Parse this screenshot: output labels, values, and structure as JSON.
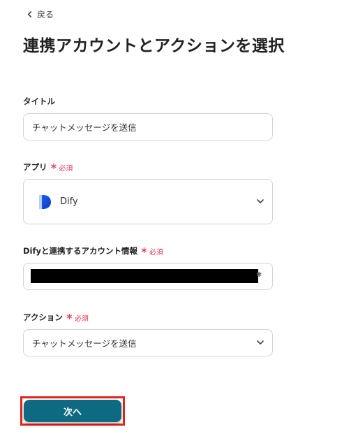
{
  "nav": {
    "back_label": "戻る"
  },
  "page": {
    "title": "連携アカウントとアクションを選択"
  },
  "form": {
    "title_field": {
      "label": "タイトル",
      "value": "チャットメッセージを送信"
    },
    "app_field": {
      "label": "アプリ",
      "required_label": "必須",
      "value": "Dify",
      "icon": "dify-logo"
    },
    "account_field": {
      "label": "Difyと連携するアカウント情報",
      "required_label": "必須"
    },
    "action_field": {
      "label": "アクション",
      "required_label": "必須",
      "value": "チャットメッセージを送信"
    }
  },
  "actions": {
    "next_label": "次へ"
  },
  "colors": {
    "primary_button": "#0e6a80",
    "required": "#e0334f",
    "highlight_border": "#e0251d"
  }
}
